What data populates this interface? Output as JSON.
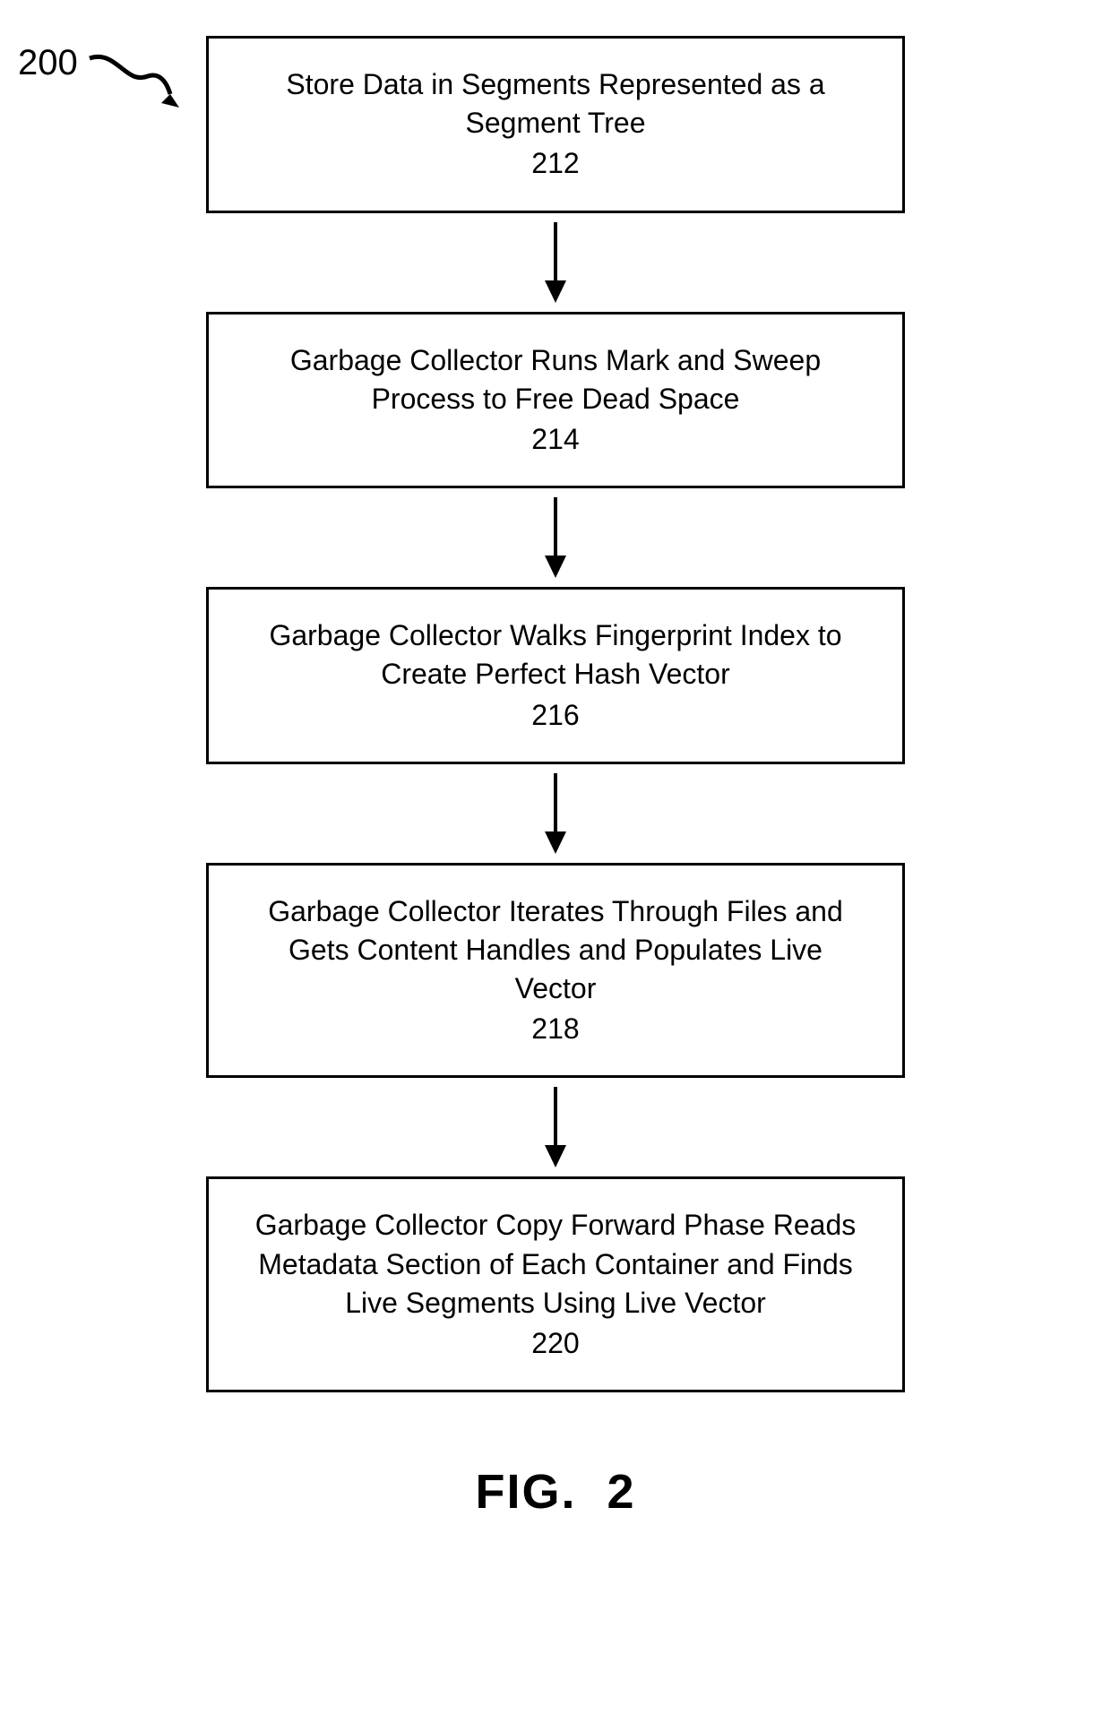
{
  "reference": "200",
  "steps": [
    {
      "text": "Store Data in Segments Represented as a Segment Tree",
      "num": "212"
    },
    {
      "text": "Garbage Collector Runs Mark and Sweep Process to Free Dead Space",
      "num": "214"
    },
    {
      "text": "Garbage Collector Walks Fingerprint Index to Create Perfect Hash Vector",
      "num": "216"
    },
    {
      "text": "Garbage Collector Iterates Through Files and Gets Content Handles and Populates Live Vector",
      "num": "218"
    },
    {
      "text": "Garbage Collector Copy Forward Phase Reads Metadata Section of Each Container and Finds Live Segments Using Live Vector",
      "num": "220"
    }
  ],
  "figureLabel": "FIG.  2"
}
